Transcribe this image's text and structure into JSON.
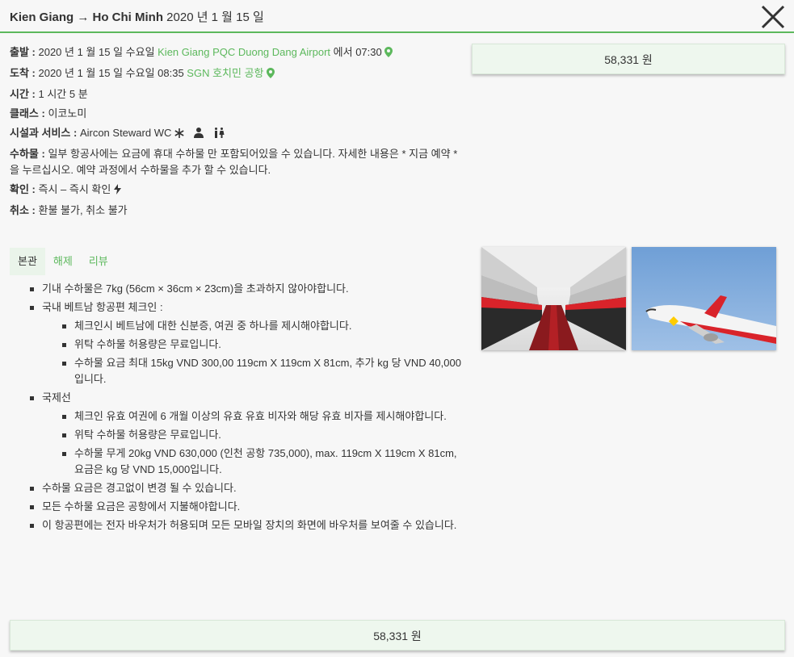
{
  "header": {
    "route": "Kien Giang → Ho Chi Minh",
    "date": " 2020 년 1 월 15 일"
  },
  "details": {
    "departure": {
      "label": "출발 :",
      "datetime": " 2020 년 1 월 15 일 수요일 ",
      "airport": "Kien Giang PQC Duong Dang Airport",
      "time": " 에서 07:30"
    },
    "arrival": {
      "label": "도착 :",
      "datetime": " 2020 년 1 월 15 일 수요일 08:35 ",
      "airport": "SGN 호치민 공항"
    },
    "duration": {
      "label": "시간 :",
      "value": " 1 시간 5 분"
    },
    "class": {
      "label": "클래스 :",
      "value": " 이코노미"
    },
    "facilities": {
      "label": "시설과 서비스 :",
      "value": " Aircon Steward WC"
    },
    "baggage": {
      "label": "수하물 :",
      "value": " 일부 항공사에는 요금에 휴대 수하물 만 포함되어있을 수 있습니다. 자세한 내용은 * 지금 예약 *을 누르십시오. 예약 과정에서 수하물을 추가 할 수 있습니다."
    },
    "confirmation": {
      "label": "확인 :",
      "value": " 즉시 – 즉시 확인"
    },
    "cancellation": {
      "label": "취소 :",
      "value": " 환불 불가, 취소 불가"
    }
  },
  "price": {
    "amount": "58,331 원"
  },
  "tabs": [
    "본관",
    "해제",
    "리뷰"
  ],
  "rules": {
    "carry_on": "기내 수하물은 7kg (56cm × 36cm × 23cm)을 초과하지 않아야합니다.",
    "domestic": "국내 베트남 항공편 체크인 :",
    "domestic_items": [
      "체크인시 베트남에 대한 신분증, 여권 중 하나를 제시해야합니다.",
      "위탁 수하물 허용량은 무료입니다.",
      "수하물 요금 최대 15kg VND 300,00 119cm X 119cm X 81cm, 추가 kg 당 VND 40,000입니다."
    ],
    "international": "국제선",
    "international_items": [
      "체크인 유효 여권에 6 개월 이상의 유효 유효 비자와 해당 유효 비자를 제시해야합니다.",
      "위탁 수하물 허용량은 무료입니다.",
      "수하물 무게 20kg VND 630,000 (인천 공항 735,000), max. 119cm X 119cm X 81cm, 요금은 kg 당 VND 15,000입니다."
    ],
    "change_notice": "수하물 요금은 경고없이 변경 될 수 있습니다.",
    "airport_payment": "모든 수하물 요금은 공항에서 지불해야합니다.",
    "e_voucher": "이 항공편에는 전자 바우처가 허용되며 모든 모바일 장치의 화면에 바우처를 보여줄 수 있습니다."
  },
  "colors": {
    "accent": "#5cb85c",
    "price_bg": "#eef7ee",
    "brand_red": "#d9232a"
  },
  "icons": [
    "close-icon",
    "map-pin-icon",
    "snowflake-icon",
    "steward-icon",
    "restroom-icon",
    "bolt-icon"
  ]
}
